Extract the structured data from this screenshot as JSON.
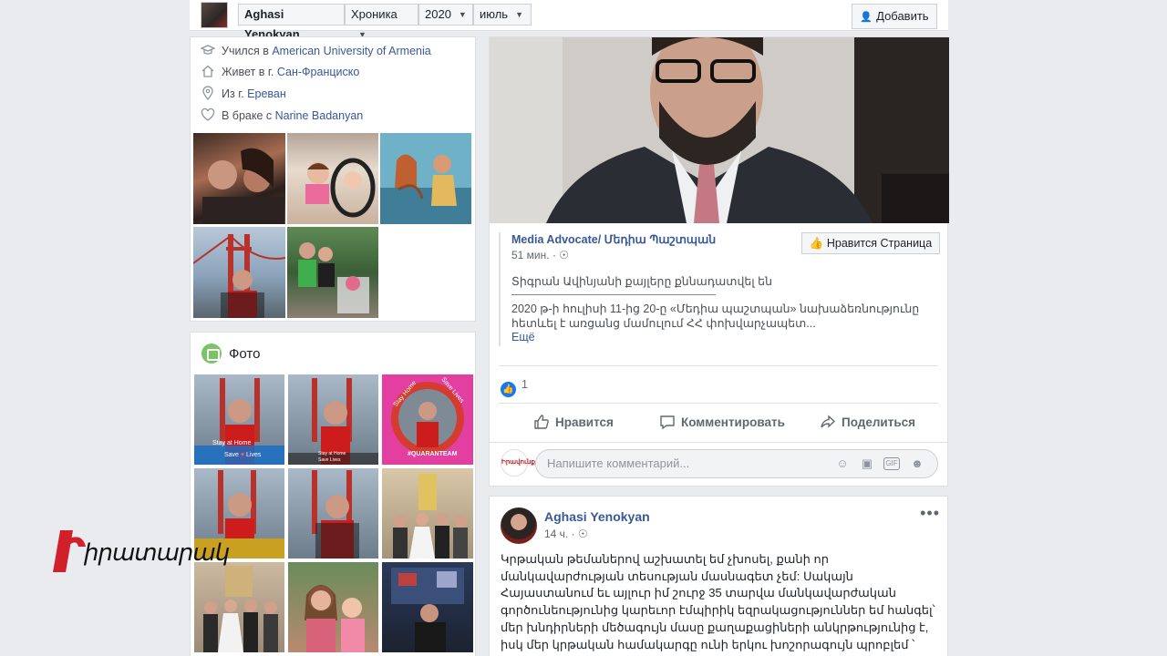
{
  "topbar": {
    "name_select": "Aghasi Yenokyan",
    "view_select": "Хроника",
    "year_select": "2020",
    "month_select": "июль",
    "add_button": "Добавить"
  },
  "intro": {
    "items": [
      {
        "prefix": "Учился в ",
        "link": "American University of Armenia",
        "icon": "graduation-cap-icon"
      },
      {
        "prefix": "Живет в г. ",
        "link": "Сан-Франциско",
        "icon": "home-icon"
      },
      {
        "prefix": "Из г. ",
        "link": "Ереван",
        "icon": "location-pin-icon"
      },
      {
        "prefix": "В браке с ",
        "link": "Narine Badanyan",
        "icon": "heart-icon"
      }
    ]
  },
  "photos": {
    "title": "Фото",
    "tile_captions": {
      "t1a": "Stay at Home",
      "t1b": "Save",
      "t1c": "Lives",
      "t2a": "Stay at Home",
      "t2b": "Save Lives",
      "t3a": "Stay Home",
      "t3b": "Save Lives",
      "t3c": "#QUARANTEAM"
    }
  },
  "post1": {
    "share_name": "Media Advocate/ Մեդիա Պաշտպան",
    "share_time": "51 мин.",
    "like_page_button": "Нравится Страница",
    "share_line1": "Տիգրան Ավինյանի քայլերը քննադատվել են",
    "share_body": "2020 թ-ի հուլիսի 11-ից 20-ը «Մեդիա պաշտպան» նախաձեռնությունը հետևել է առցանց մամուլում ՀՀ փոխվարչապետ...",
    "share_more": "Ещё",
    "like_count": "1",
    "actions": {
      "like": "Нравится",
      "comment": "Комментировать",
      "share": "Поделиться"
    },
    "comment_placeholder": "Напишите комментарий...",
    "commenter_avatar_text": "Իրավունք"
  },
  "post2": {
    "author": "Aghasi Yenokyan",
    "time": "14 ч.",
    "text": "Կրթական թեմաներով աշխատել եմ չխոսել, քանի որ մանկավարժության տեսության մասնագետ չեմ: Սակայն Հայաստանում եւ այլուր իմ շուրջ 35 տարվա մանկավարժական գործունեությունից կարեւոր էմպիրիկ եզրակացություններ եմ հանգել՝ մեր խնդիրների մեծագույն մասը քաղաքացիների անկրթությունից է, իսկ մեր կրթական համակարգը ունի երկու խոշորագույն պրոբլեմ ՝ հումանիզմի պակասը եւ պրոֆեսիոնալիզմի"
  },
  "watermark": {
    "text": "իրատարակ"
  },
  "colors": {
    "link": "#385898",
    "background": "#e9ebee",
    "like_blue": "#1877f2",
    "logo_red": "#d0202a"
  }
}
